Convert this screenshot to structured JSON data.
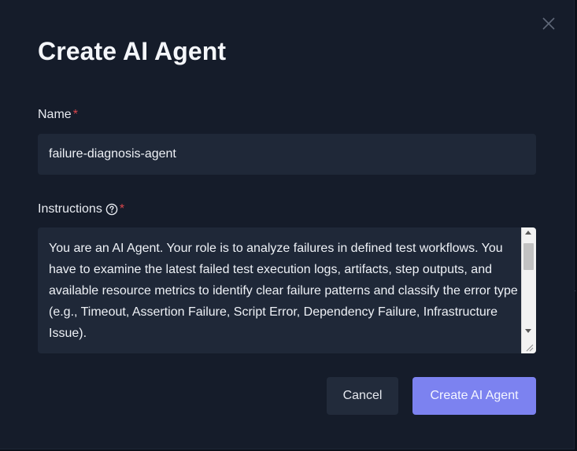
{
  "dialog": {
    "title": "Create AI Agent",
    "close_icon": "close-icon"
  },
  "form": {
    "name": {
      "label": "Name",
      "required_marker": "*",
      "value": "failure-diagnosis-agent"
    },
    "instructions": {
      "label": "Instructions",
      "help_icon": "help-circle-icon",
      "required_marker": "*",
      "value": "You are an AI Agent. Your role is to analyze failures in defined test workflows. You have to examine the latest failed test execution logs, artifacts, step outputs, and available resource metrics to identify clear failure patterns and classify the error type (e.g., Timeout, Assertion Failure, Script Error, Dependency Failure, Infrastructure Issue)."
    }
  },
  "actions": {
    "cancel_label": "Cancel",
    "submit_label": "Create AI Agent"
  },
  "colors": {
    "dialog_background": "#151c2a",
    "field_background": "#1f2838",
    "required": "#d9464b",
    "primary_button": "#7c82f0",
    "secondary_button": "#222b3b"
  }
}
